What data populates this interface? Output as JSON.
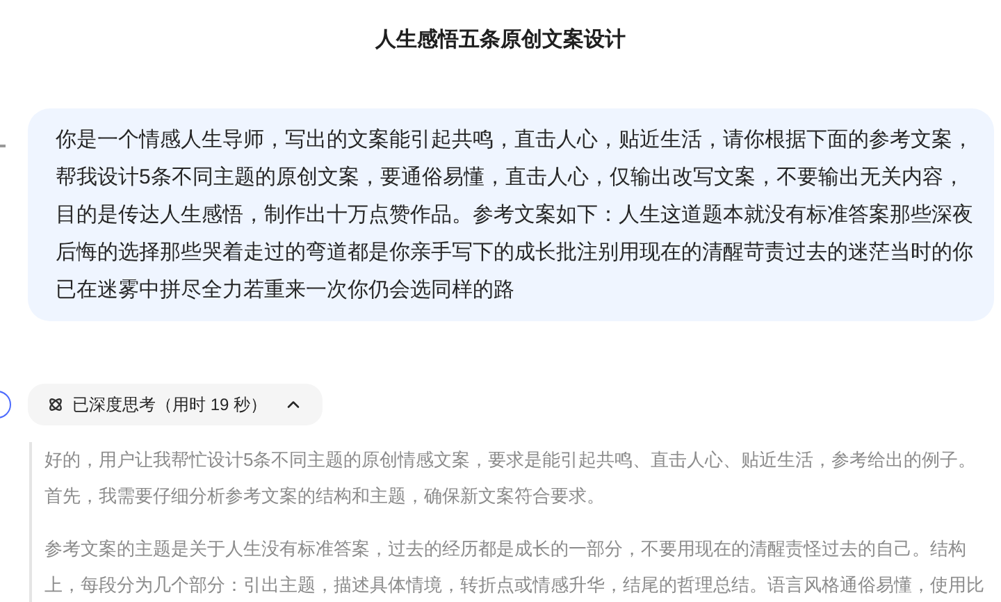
{
  "title": "人生感悟五条原创文案设计",
  "user_message": "你是一个情感人生导师，写出的文案能引起共鸣，直击人心，贴近生活，请你根据下面的参考文案，帮我设计5条不同主题的原创文案，要通俗易懂，直击人心，仅输出改写文案，不要输出无关内容，目的是传达人生感悟，制作出十万点赞作品。参考文案如下：人生这道题本就没有标准答案那些深夜后悔的选择那些哭着走过的弯道都是你亲手写下的成长批注别用现在的清醒苛责过去的迷茫当时的你已在迷雾中拼尽全力若重来一次你仍会选同样的路",
  "thinking": {
    "label": "已深度思考（用时 19 秒）",
    "expanded": true,
    "paragraphs": [
      "好的，用户让我帮忙设计5条不同主题的原创情感文案，要求是能引起共鸣、直击人心、贴近生活，参考给出的例子。首先，我需要仔细分析参考文案的结构和主题，确保新文案符合要求。",
      "参考文案的主题是关于人生没有标准答案，过去的经历都是成长的一部分，不要用现在的清醒责怪过去的自己。结构上，每段分为几个部分：引出主题，描述具体情境，转折点或情感升华，结尾的哲理总结。语言风格通俗易懂，使用比"
    ]
  }
}
